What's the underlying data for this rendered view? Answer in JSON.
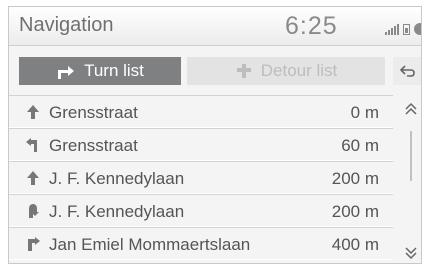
{
  "header": {
    "title": "Navigation",
    "time": "6:25",
    "icons": [
      "signal-icon",
      "battery-icon",
      "status-icon"
    ]
  },
  "tabs": {
    "turn_list": {
      "label": "Turn list",
      "icon": "turn-list-icon",
      "active": true
    },
    "detour_list": {
      "label": "Detour list",
      "icon": "detour-icon",
      "active": false
    }
  },
  "back": {
    "icon": "back-arrow-icon"
  },
  "turns": [
    {
      "icon": "straight-arrow-icon",
      "street": "Grensstraat",
      "distance": "0 m"
    },
    {
      "icon": "turn-left-icon",
      "street": "Grensstraat",
      "distance": "60 m"
    },
    {
      "icon": "straight-arrow-icon",
      "street": "J. F. Kennedylaan",
      "distance": "200 m"
    },
    {
      "icon": "u-turn-icon",
      "street": "J. F. Kennedylaan",
      "distance": "200 m"
    },
    {
      "icon": "turn-right-icon",
      "street": "Jan Emiel Mommaertslaan",
      "distance": "400 m"
    }
  ],
  "scroll": {
    "up_icon": "scroll-up-icon",
    "down_icon": "scroll-down-icon"
  },
  "colors": {
    "active_tab": "#7e8082",
    "inactive_tab": "#e3e3e3",
    "text": "#555555"
  }
}
